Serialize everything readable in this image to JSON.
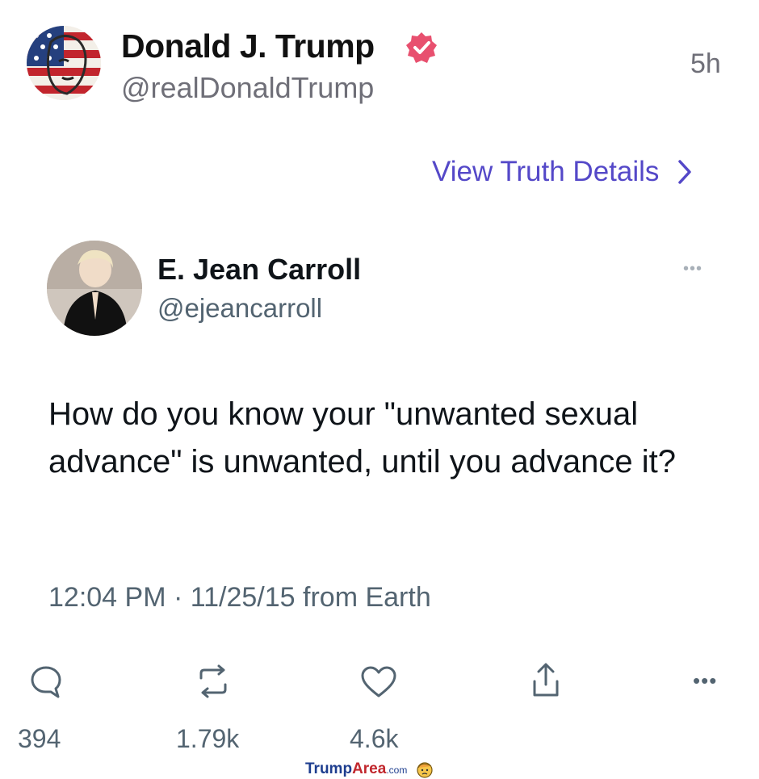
{
  "header": {
    "author_name": "Donald J. Trump",
    "author_handle": "@realDonaldTrump",
    "time_ago": "5h",
    "details_link": "View Truth Details",
    "verified_color": "#e8506f"
  },
  "quoted_post": {
    "author_name": "E. Jean Carroll",
    "author_handle": "@ejeancarroll",
    "more_glyph": "•••",
    "text": "How do you know your \"unwanted sexual advance\" is unwanted, until you advance it?",
    "meta": "12:04 PM · 11/25/15 from Earth"
  },
  "actions": {
    "replies": "394",
    "reposts": "1.79k",
    "likes": "4.6k",
    "more_glyph": "•••"
  },
  "watermark": {
    "part1": "Trump",
    "part2": "Area",
    "part3": ".com"
  },
  "colors": {
    "accent_link": "#5448c8",
    "muted_text": "#536471"
  }
}
